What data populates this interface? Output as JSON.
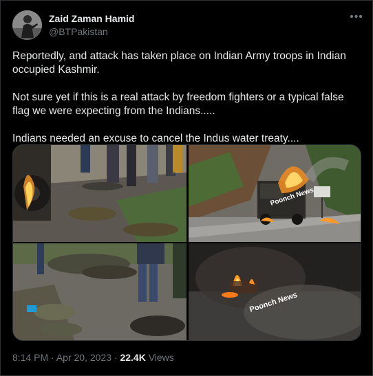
{
  "author": {
    "display_name": "Zaid Zaman Hamid",
    "handle": "@BTPakistan",
    "avatar_icon": "user-avatar"
  },
  "more_icon": "more-options-icon",
  "tweet": {
    "paragraphs": [
      "Reportedly, and attack has taken place on Indian Army troops in Indian occupied Kashmir.",
      "Not sure yet if this is a real attack by freedom fighters or a typical false flag we were expecting from the Indians.....",
      "Indians needed an excuse to cancel the Indus water treaty...."
    ]
  },
  "media": {
    "watermark_2": "Poonch News",
    "watermark_4": "Poonch News"
  },
  "footer": {
    "time": "8:14 PM",
    "separator": "·",
    "date": "Apr 20, 2023",
    "separator2": "·",
    "views_count": "22.4K",
    "views_label": "Views"
  },
  "colors": {
    "background": "#000000",
    "text_primary": "#e7e9ea",
    "text_secondary": "#71767b",
    "border": "#2f3336"
  }
}
